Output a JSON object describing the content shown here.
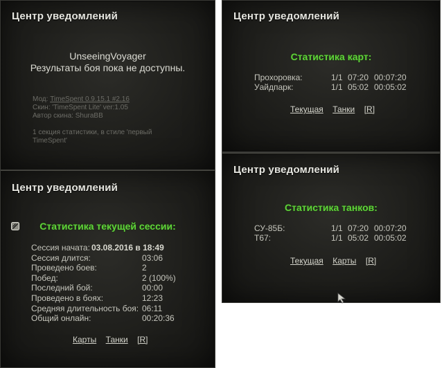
{
  "panel1": {
    "title": "Центр уведомлений",
    "player": "UnseeingVoyager",
    "message": "Результаты боя пока не доступны.",
    "mod_label": "Мод:",
    "mod_value": "TimeSpent 0.9.15.1 #2.16",
    "skin_line": "Скин: 'TimeSpent Lite' ver:1.05",
    "author_line": "Автор скина: ShuraBB",
    "desc_line1": "1 секция статистики, в стиле 'первый",
    "desc_line2": "TimeSpent'"
  },
  "panel2": {
    "title": "Центр уведомлений",
    "heading": "Статистика текущей сессии:",
    "rows": [
      {
        "label": "Сессия начата:",
        "value": "03.08.2016 в 18:49"
      },
      {
        "label": "Сессия длится:",
        "value": "03:06"
      },
      {
        "label": "Проведено боев:",
        "value": "2"
      },
      {
        "label": "Побед:",
        "value": "2 (100%)"
      },
      {
        "label": "Последний бой:",
        "value": "00:00"
      },
      {
        "label": "Проведено в боях:",
        "value": "12:23"
      },
      {
        "label": "Средняя длительность боя:",
        "value": "06:11"
      },
      {
        "label": "Общий онлайн:",
        "value": "00:20:36"
      }
    ],
    "links": [
      "Карты",
      "Танки",
      "[R]"
    ]
  },
  "panel3": {
    "title": "Центр уведомлений",
    "heading": "Статистика карт:",
    "rows": [
      {
        "name": "Прохоровка:",
        "ratio": "1/1",
        "avg": "07:20",
        "total": "00:07:20"
      },
      {
        "name": "Уайдпарк:",
        "ratio": "1/1",
        "avg": "05:02",
        "total": "00:05:02"
      }
    ],
    "links": [
      "Текущая",
      "Танки",
      "[R]"
    ]
  },
  "panel4": {
    "title": "Центр уведомлений",
    "heading": "Статистика танков:",
    "rows": [
      {
        "name": "СУ-85Б:",
        "ratio": "1/1",
        "avg": "07:20",
        "total": "00:07:20"
      },
      {
        "name": "T67:",
        "ratio": "1/1",
        "avg": "05:02",
        "total": "00:05:02"
      }
    ],
    "links": [
      "Текущая",
      "Карты",
      "[R]"
    ]
  },
  "colors": {
    "accent_green": "#5fd43a",
    "panel_bg": "#1e1e1b",
    "text": "#c6c6bd"
  }
}
